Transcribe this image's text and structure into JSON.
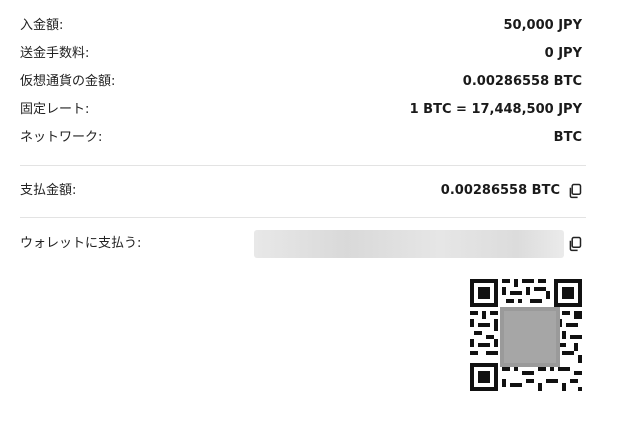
{
  "summary": {
    "rows": [
      {
        "label": "入金額:",
        "value": "50,000 JPY"
      },
      {
        "label": "送金手数料:",
        "value": "0 JPY"
      },
      {
        "label": "仮想通貨の金額:",
        "value": "0.00286558 BTC"
      },
      {
        "label": "固定レート:",
        "value": "1 BTC = 17,448,500 JPY"
      },
      {
        "label": "ネットワーク:",
        "value": "BTC"
      }
    ]
  },
  "payment": {
    "amount_label": "支払金額:",
    "amount_value": "0.00286558 BTC",
    "wallet_label": "ウォレットに支払う:"
  },
  "icons": {
    "copy_amount": "copy-icon",
    "copy_address": "copy-icon"
  }
}
